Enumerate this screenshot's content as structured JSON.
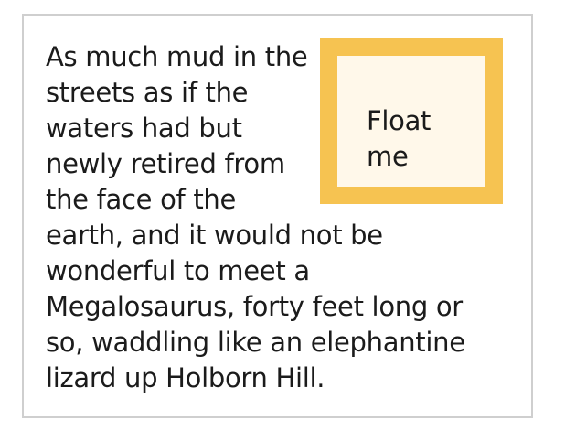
{
  "float_box": {
    "label": "Float me",
    "border_color": "#f6c351",
    "background_color": "#fff8ea"
  },
  "paragraph": {
    "text": "As much mud in the streets as if the waters had but newly retired from the face of the earth, and it would not be wonderful to meet a Megalosaurus, forty feet long or so, waddling like an elephantine lizard up Holborn Hill."
  },
  "frame": {
    "border_color": "#cfcfcf"
  }
}
